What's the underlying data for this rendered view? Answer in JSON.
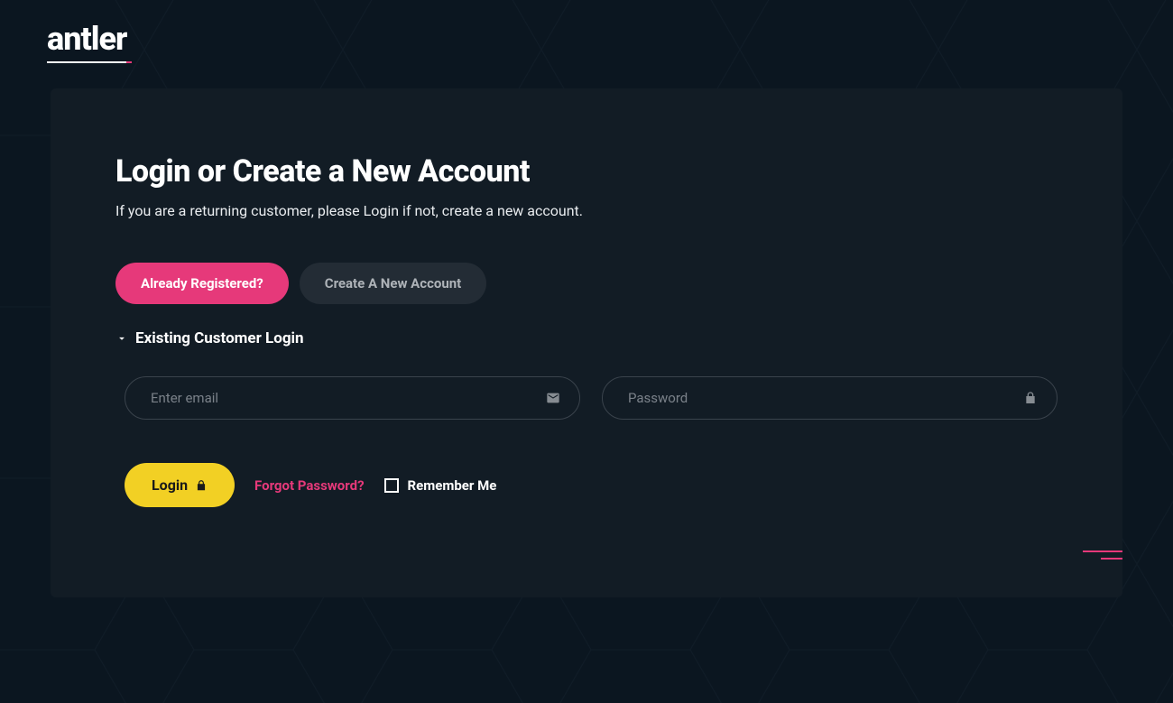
{
  "brand": {
    "name": "antler"
  },
  "page": {
    "title": "Login or Create a New Account",
    "subtitle": "If you are a returning customer, please Login if not, create a new account."
  },
  "tabs": {
    "registered": "Already Registered?",
    "create": "Create A New Account"
  },
  "section": {
    "title": "Existing Customer Login"
  },
  "form": {
    "email_placeholder": "Enter email",
    "password_placeholder": "Password",
    "login_label": "Login",
    "forgot_label": "Forgot Password?",
    "remember_label": "Remember Me"
  },
  "colors": {
    "accent_pink": "#e6397a",
    "accent_yellow": "#f2d024",
    "bg": "#0b1620",
    "card": "#121c25"
  }
}
